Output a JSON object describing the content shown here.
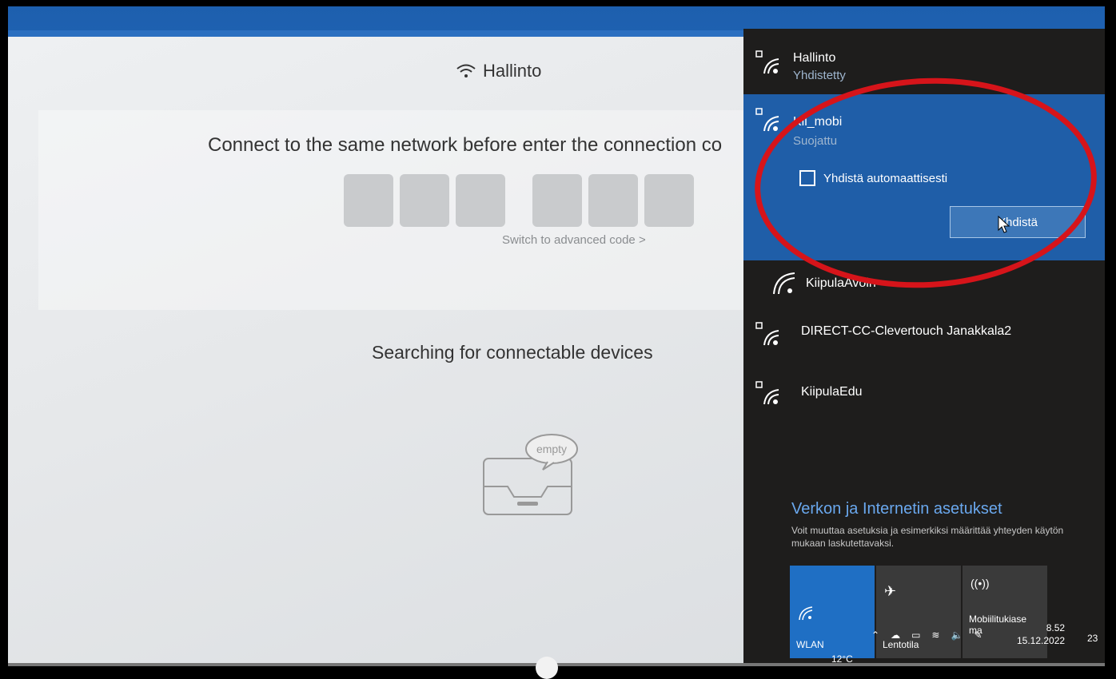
{
  "app": {
    "network_title": "Hallinto",
    "connect_instruction": "Connect to the same network before enter the connection co",
    "advanced_code_link": "Switch to advanced code >",
    "searching_text": "Searching for connectable devices",
    "empty_label": "empty"
  },
  "flyout": {
    "networks": [
      {
        "name": "Hallinto",
        "status": "Yhdistetty",
        "secured": true
      },
      {
        "name": "Kii_mobi",
        "status": "Suojattu",
        "secured": true,
        "selected": true
      },
      {
        "name": "KiipulaAvoin",
        "status": "",
        "secured": false
      },
      {
        "name": "DIRECT-CC-Clevertouch Janakkala2",
        "status": "",
        "secured": true
      },
      {
        "name": "KiipulaEdu",
        "status": "",
        "secured": true
      }
    ],
    "auto_connect_label": "Yhdistä automaattisesti",
    "auto_connect_checked": false,
    "connect_button": "Yhdistä",
    "settings_title": "Verkon ja Internetin asetukset",
    "settings_description": "Voit muuttaa asetuksia ja esimerkiksi määrittää yhteyden käytön mukaan laskutettavaksi.",
    "tiles": [
      {
        "label": "WLAN",
        "active": true
      },
      {
        "label": "Lentotila",
        "active": false
      },
      {
        "label": "Mobiilitukiase ma",
        "active": false
      }
    ],
    "accent": "#1f5ea8"
  },
  "taskbar": {
    "time": "8.52",
    "date": "15.12.2022",
    "temperature": "12°C",
    "notification_count": "23"
  },
  "annotation_color": "#d6141a"
}
